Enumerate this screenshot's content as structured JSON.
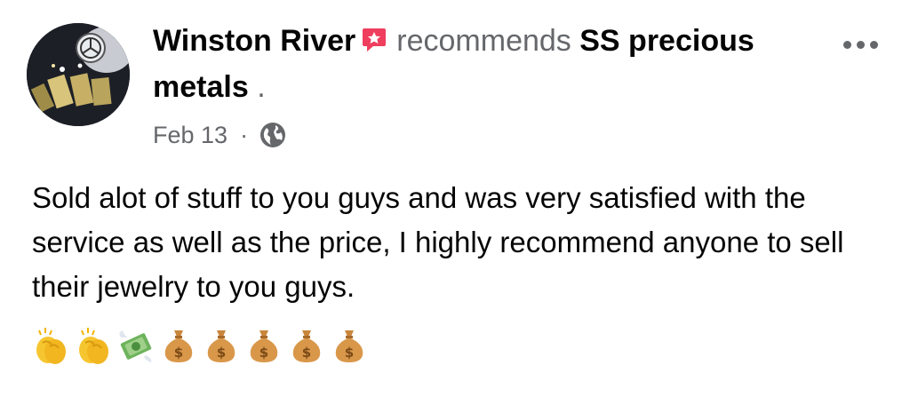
{
  "post": {
    "author_name": "Winston River",
    "verb": "recommends",
    "page_name": "SS precious metals",
    "trailing_punct": ".",
    "date": "Feb 13",
    "separator": "·",
    "audience_icon": "globe-icon",
    "body": "Sold alot of stuff to you guys and was very satisfied with the service as well as the price, I highly recommend anyone to sell their jewelry to you guys.",
    "emojis": [
      "clapping-hands",
      "clapping-hands",
      "money-with-wings",
      "money-bag",
      "money-bag",
      "money-bag",
      "money-bag",
      "money-bag"
    ]
  },
  "colors": {
    "badge": "#ef3e5e",
    "secondary_text": "#65676b",
    "primary_text": "#050505"
  },
  "icons": {
    "more": "more-options-icon",
    "recommend_badge": "recommendation-badge-icon"
  }
}
